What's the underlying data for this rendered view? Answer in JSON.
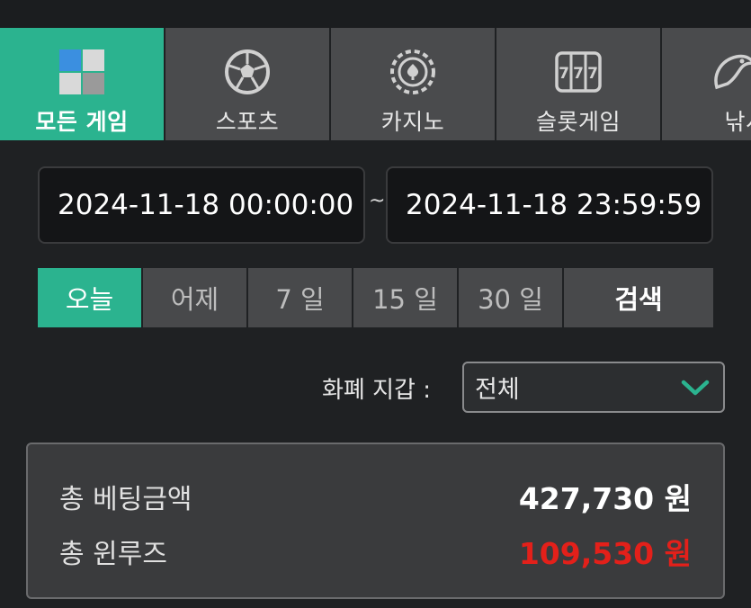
{
  "tabs": [
    {
      "label": "모든 게임",
      "icon": "all-games-icon",
      "active": true
    },
    {
      "label": "스포츠",
      "icon": "soccer-ball-icon",
      "active": false
    },
    {
      "label": "카지노",
      "icon": "casino-chip-icon",
      "active": false
    },
    {
      "label": "슬롯게임",
      "icon": "slot-machine-icon",
      "active": false
    },
    {
      "label": "낚시",
      "icon": "fish-icon",
      "active": false
    }
  ],
  "date_range": {
    "start": "2024-11-18 00:00:00",
    "separator": "~",
    "end": "2024-11-18 23:59:59"
  },
  "periods": {
    "today": "오늘",
    "yesterday": "어제",
    "days7": "7 일",
    "days15": "15 일",
    "days30": "30 일",
    "search": "검색"
  },
  "wallet": {
    "label": "화폐 지갑 :",
    "selected": "전체"
  },
  "summary": {
    "total_bet_label": "총 베팅금액",
    "total_bet_value": "427,730 원",
    "total_winloss_label": "총 윈루즈",
    "total_winloss_value": "109,530 원"
  },
  "colors": {
    "accent": "#2bb38f",
    "negative": "#e3201a",
    "background": "#1f2123"
  }
}
